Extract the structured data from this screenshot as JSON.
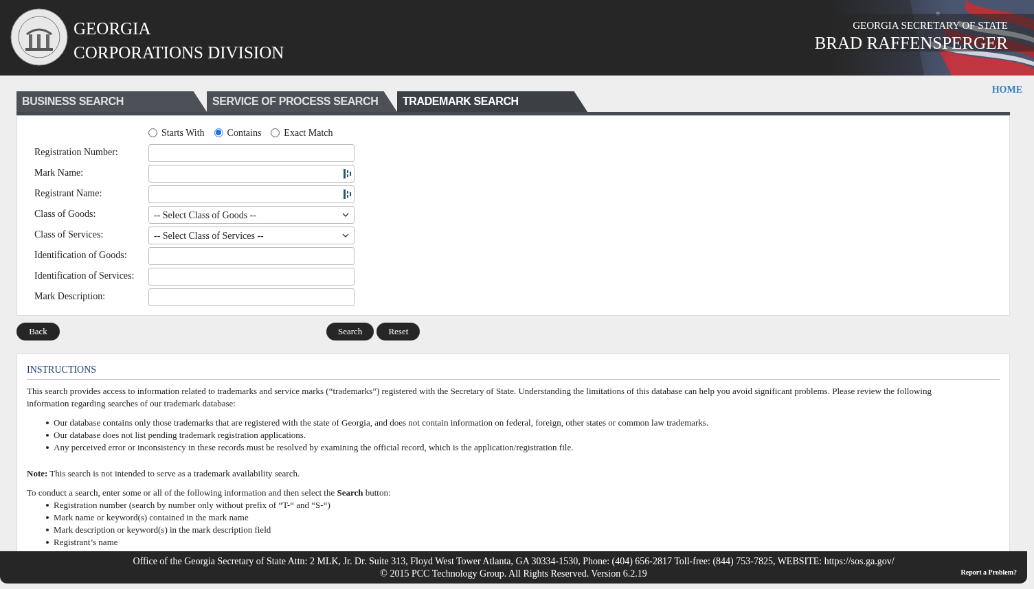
{
  "header": {
    "title_lines": [
      "GEORGIA",
      "CORPORATIONS DIVISION"
    ],
    "subtitle": "GEORGIA SECRETARY OF STATE",
    "name": "BRAD RAFFENSPERGER"
  },
  "home_link": "HOME",
  "tabs": [
    {
      "label": "BUSINESS SEARCH",
      "selected": false
    },
    {
      "label": "SERVICE OF PROCESS SEARCH",
      "selected": false
    },
    {
      "label": "TRADEMARK SEARCH",
      "selected": true
    }
  ],
  "match_options": [
    {
      "label": "Starts With",
      "selected": false
    },
    {
      "label": "Contains",
      "selected": true
    },
    {
      "label": "Exact Match",
      "selected": false
    }
  ],
  "fields": [
    {
      "label": "Registration Number:",
      "kind": "text"
    },
    {
      "label": "Mark Name:",
      "kind": "autofill"
    },
    {
      "label": "Registrant Name:",
      "kind": "autofill"
    },
    {
      "label": "Class of Goods:",
      "kind": "select",
      "value": "-- Select Class of Goods --"
    },
    {
      "label": "Class of Services:",
      "kind": "select",
      "value": "-- Select Class of Services --"
    },
    {
      "label": "Identification of Goods:",
      "kind": "text"
    },
    {
      "label": "Identification of Services:",
      "kind": "text"
    },
    {
      "label": "Mark Description:",
      "kind": "text"
    }
  ],
  "back_button": "Back",
  "action_buttons": [
    "Search",
    "Reset"
  ],
  "instructions": {
    "heading": "INSTRUCTIONS",
    "intro": "This search provides access to information related to trademarks and service marks (“trademarks”) registered with the Secretary of State. Understanding the limitations of this database can help you avoid significant problems. Please review the following information regarding searches of our trademark database:",
    "bullets": [
      "Our database contains only those trademarks that are registered with the state of Georgia, and does not contain information on federal, foreign, other states or common law trademarks.",
      "Our database does not list pending trademark registration applications.",
      "Any perceived error or inconsistency in these records must be resolved by examining the official record, which is the application/registration file."
    ],
    "note": "**Note:** This search is not intended to serve as a trademark availability search.",
    "how_to": "To conduct a search, enter some or all of the following information and then select the **Search** button:",
    "search_items": [
      "Registration number (search by number only without prefix of “T-“ and “S-“)",
      "Mark name or keyword(s) contained in the mark name",
      "Mark description or keyword(s) in the mark description field",
      "Registrant’s name"
    ]
  },
  "footer": {
    "lines": [
      "Office of the Georgia Secretary of State Attn: 2 MLK, Jr. Dr. Suite 313, Floyd West Tower Atlanta, GA 30334-1530, Phone: (404) 656-2817 Toll-free: (844) 753-7825, WEBSITE: https://sos.ga.gov/",
      "© 2015 PCC Technology Group. All Rights Reserved. Version 6.2.19"
    ],
    "report_link": "Report a Problem?"
  }
}
